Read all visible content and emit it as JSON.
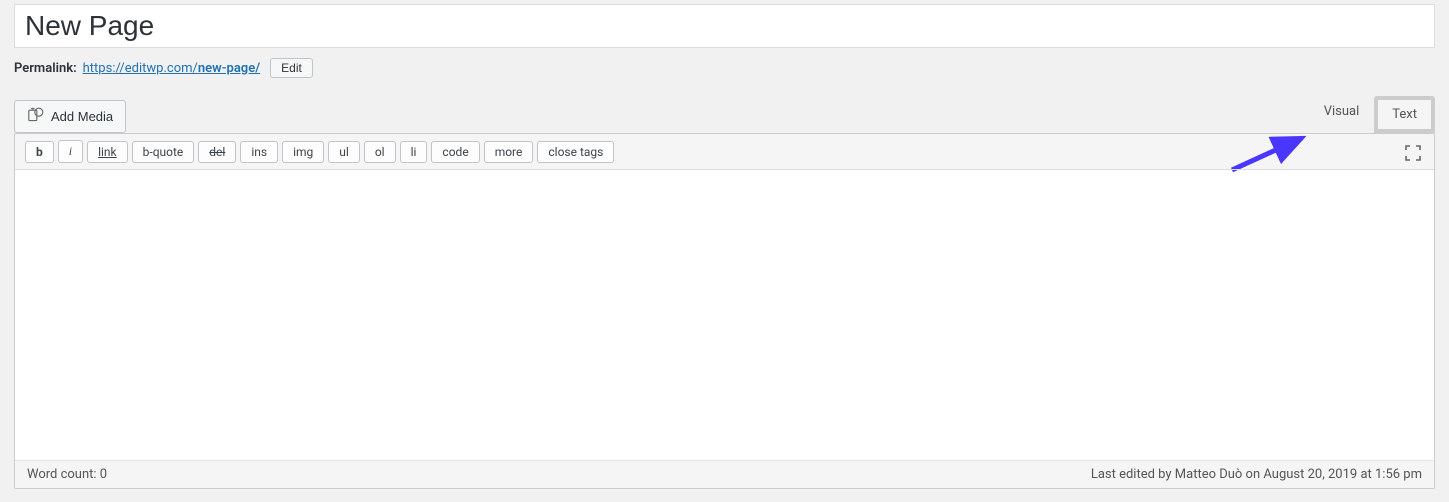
{
  "title": "New Page",
  "permalink": {
    "label": "Permalink:",
    "base": "https://editwp.com/",
    "slug": "new-page/",
    "edit_label": "Edit"
  },
  "toolbar": {
    "add_media": "Add Media"
  },
  "tabs": {
    "visual": "Visual",
    "text": "Text"
  },
  "quicktags": {
    "b": "b",
    "i": "i",
    "link": "link",
    "bquote": "b-quote",
    "del": "del",
    "ins": "ins",
    "img": "img",
    "ul": "ul",
    "ol": "ol",
    "li": "li",
    "code": "code",
    "more": "more",
    "close": "close tags"
  },
  "content": "",
  "status": {
    "word_count_label": "Word count: ",
    "word_count_value": "0",
    "last_edited": "Last edited by Matteo Duò on August 20, 2019 at 1:56 pm"
  }
}
